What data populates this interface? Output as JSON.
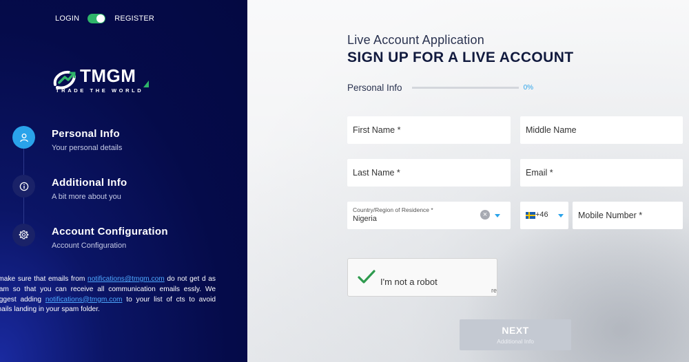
{
  "auth": {
    "login_label": "LOGIN",
    "register_label": "REGISTER",
    "toggle_state": "register"
  },
  "brand": {
    "name": "TMGM",
    "tagline": "TRADE THE WORLD"
  },
  "steps": [
    {
      "title": "Personal Info",
      "subtitle": "Your personal details",
      "icon": "user-icon",
      "active": true
    },
    {
      "title": "Additional Info",
      "subtitle": "A bit more about you",
      "icon": "info-icon",
      "active": false
    },
    {
      "title": "Account Configuration",
      "subtitle": "Account Configuration",
      "icon": "gear-icon",
      "active": false
    }
  ],
  "notice": {
    "part1": "e make sure that emails from ",
    "email": "notifications@tmgm.com",
    "part2": " do not get d as spam so that you can receive all communication emails essly. We suggest adding ",
    "part3": " to your list of cts to avoid emails landing in your spam folder."
  },
  "form": {
    "app_title": "Live Account Application",
    "main_title": "SIGN UP FOR A LIVE ACCOUNT",
    "section": "Personal Info",
    "progress_percent": 0,
    "progress_label": "0%",
    "first_name_placeholder": "First Name *",
    "middle_name_placeholder": "Middle Name",
    "last_name_placeholder": "Last Name *",
    "email_placeholder": "Email *",
    "country_label": "Country/Region of Residence *",
    "country_value": "Nigeria",
    "phone_code": "+46",
    "mobile_placeholder": "Mobile Number *",
    "captcha_text": "I'm not a robot",
    "captcha_re": "re",
    "next_label": "NEXT",
    "next_sub": "Additional Info"
  },
  "colors": {
    "accent": "#2aa3ea",
    "panel": "#050b4a",
    "toggle": "#2fb56a",
    "disabled_button": "#c4c9d2"
  }
}
